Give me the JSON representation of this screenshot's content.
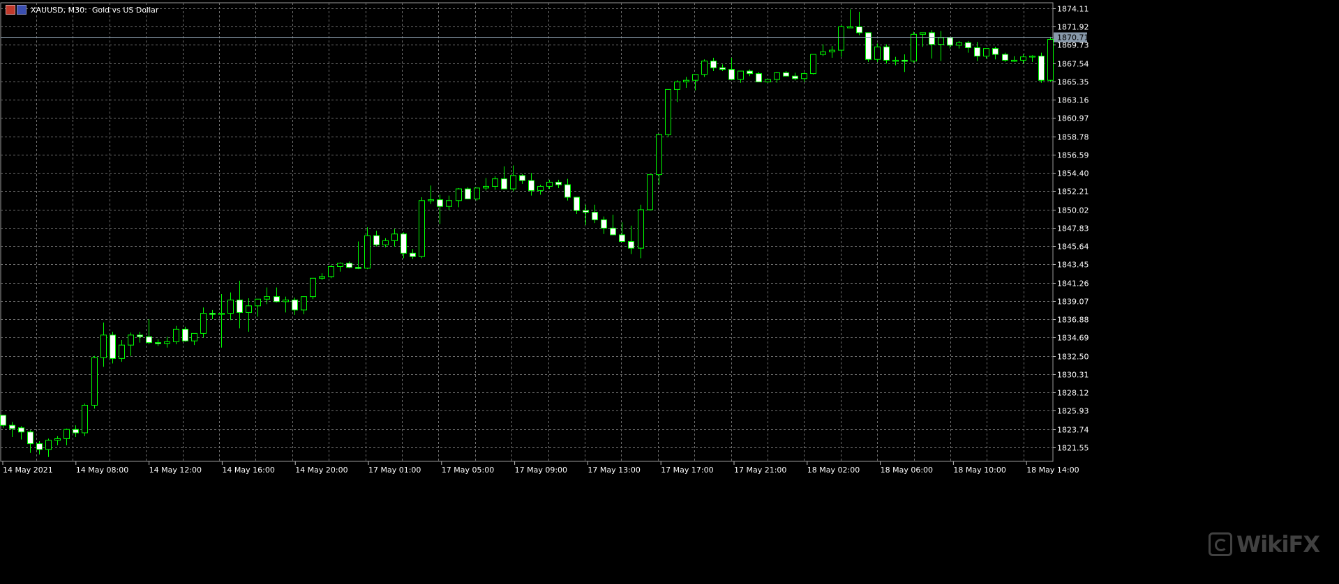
{
  "window": {
    "symbol": "XAUUSD, M30:",
    "description": "Gold vs US Dollar"
  },
  "watermark": {
    "text": "WikiFX"
  },
  "colors": {
    "background": "#000000",
    "grid": "#707070",
    "candle_outline": "#00ff00",
    "bull_body": "#000000",
    "bear_body": "#ffffff",
    "axis_text": "#ffffff",
    "price_line": "#8899aa",
    "price_badge_bg": "#8899aa"
  },
  "chart_data": {
    "type": "candlestick",
    "timeframe": "M30",
    "current_price": 1870.71,
    "price_ticks": [
      "1874.11",
      "1871.92",
      "1869.73",
      "1867.54",
      "1865.35",
      "1863.16",
      "1860.97",
      "1858.78",
      "1856.59",
      "1854.40",
      "1852.21",
      "1850.02",
      "1847.83",
      "1845.64",
      "1843.45",
      "1841.26",
      "1839.07",
      "1836.88",
      "1834.69",
      "1832.50",
      "1830.31",
      "1828.12",
      "1825.93",
      "1823.74",
      "1821.55"
    ],
    "ylim": [
      1820.2,
      1875.1
    ],
    "time_labels": [
      "14 May 2021",
      "14 May 08:00",
      "14 May 12:00",
      "14 May 16:00",
      "14 May 20:00",
      "17 May 01:00",
      "17 May 05:00",
      "17 May 09:00",
      "17 May 13:00",
      "17 May 17:00",
      "17 May 21:00",
      "18 May 02:00",
      "18 May 06:00",
      "18 May 10:00",
      "18 May 14:00"
    ],
    "candles": [
      [
        1825.4,
        1825.4,
        1823.9,
        1824.2
      ],
      [
        1824.2,
        1824.6,
        1822.8,
        1823.8
      ],
      [
        1823.9,
        1824.1,
        1822.5,
        1823.4
      ],
      [
        1823.4,
        1823.6,
        1820.9,
        1822.0
      ],
      [
        1822.0,
        1822.3,
        1820.7,
        1821.3
      ],
      [
        1821.3,
        1822.6,
        1820.4,
        1822.4
      ],
      [
        1822.4,
        1822.9,
        1821.8,
        1822.6
      ],
      [
        1822.6,
        1823.8,
        1821.8,
        1823.7
      ],
      [
        1823.7,
        1824.2,
        1822.8,
        1823.3
      ],
      [
        1823.3,
        1826.8,
        1822.9,
        1826.6
      ],
      [
        1826.6,
        1832.5,
        1826.2,
        1832.3
      ],
      [
        1832.3,
        1836.5,
        1831.2,
        1835.0
      ],
      [
        1835.0,
        1835.4,
        1831.6,
        1832.2
      ],
      [
        1832.2,
        1834.4,
        1831.8,
        1833.8
      ],
      [
        1833.8,
        1835.3,
        1832.5,
        1835.0
      ],
      [
        1835.0,
        1835.4,
        1834.1,
        1834.8
      ],
      [
        1834.8,
        1836.9,
        1833.9,
        1834.1
      ],
      [
        1834.1,
        1834.5,
        1833.7,
        1834.0
      ],
      [
        1834.0,
        1834.8,
        1833.5,
        1834.2
      ],
      [
        1834.2,
        1836.1,
        1833.9,
        1835.7
      ],
      [
        1835.7,
        1836.0,
        1834.2,
        1834.3
      ],
      [
        1834.3,
        1835.1,
        1833.8,
        1835.2
      ],
      [
        1835.2,
        1838.3,
        1834.7,
        1837.6
      ],
      [
        1837.6,
        1838.0,
        1836.9,
        1837.5
      ],
      [
        1837.5,
        1839.9,
        1833.5,
        1837.6
      ],
      [
        1837.6,
        1840.1,
        1836.8,
        1839.2
      ],
      [
        1839.2,
        1841.5,
        1835.8,
        1837.7
      ],
      [
        1837.7,
        1839.4,
        1835.4,
        1838.5
      ],
      [
        1838.5,
        1839.3,
        1837.2,
        1839.3
      ],
      [
        1839.3,
        1840.7,
        1838.7,
        1839.6
      ],
      [
        1839.6,
        1840.7,
        1838.9,
        1839.0
      ],
      [
        1839.0,
        1839.6,
        1837.7,
        1839.2
      ],
      [
        1839.2,
        1839.5,
        1837.4,
        1838.0
      ],
      [
        1838.0,
        1839.6,
        1837.5,
        1839.6
      ],
      [
        1839.6,
        1841.8,
        1839.3,
        1841.8
      ],
      [
        1841.8,
        1842.4,
        1841.6,
        1842.0
      ],
      [
        1842.0,
        1843.4,
        1841.8,
        1843.2
      ],
      [
        1843.2,
        1843.7,
        1842.6,
        1843.6
      ],
      [
        1843.6,
        1843.8,
        1843.0,
        1843.1
      ],
      [
        1843.1,
        1846.2,
        1842.9,
        1843.0
      ],
      [
        1843.0,
        1847.9,
        1842.9,
        1846.9
      ],
      [
        1846.9,
        1847.5,
        1845.6,
        1845.8
      ],
      [
        1845.8,
        1846.6,
        1845.5,
        1846.3
      ],
      [
        1846.3,
        1847.7,
        1845.6,
        1847.1
      ],
      [
        1847.1,
        1847.3,
        1844.2,
        1844.8
      ],
      [
        1844.8,
        1845.3,
        1844.1,
        1844.4
      ],
      [
        1844.4,
        1851.5,
        1844.2,
        1851.1
      ],
      [
        1851.1,
        1852.9,
        1850.7,
        1851.2
      ],
      [
        1851.2,
        1851.8,
        1848.3,
        1850.4
      ],
      [
        1850.4,
        1851.7,
        1850.0,
        1851.1
      ],
      [
        1851.1,
        1852.6,
        1850.3,
        1852.5
      ],
      [
        1852.5,
        1852.7,
        1851.3,
        1851.3
      ],
      [
        1851.3,
        1852.7,
        1851.1,
        1852.6
      ],
      [
        1852.6,
        1853.8,
        1852.3,
        1852.8
      ],
      [
        1852.8,
        1854.0,
        1852.4,
        1853.7
      ],
      [
        1853.7,
        1855.2,
        1852.7,
        1852.5
      ],
      [
        1852.5,
        1855.3,
        1852.2,
        1854.1
      ],
      [
        1854.1,
        1854.3,
        1853.1,
        1853.5
      ],
      [
        1853.5,
        1854.4,
        1851.7,
        1852.3
      ],
      [
        1852.3,
        1853.0,
        1851.8,
        1852.8
      ],
      [
        1852.8,
        1853.6,
        1852.5,
        1853.3
      ],
      [
        1853.3,
        1853.6,
        1852.6,
        1853.0
      ],
      [
        1853.0,
        1853.7,
        1851.1,
        1851.5
      ],
      [
        1851.5,
        1851.5,
        1849.5,
        1849.9
      ],
      [
        1849.9,
        1850.6,
        1848.2,
        1849.7
      ],
      [
        1849.7,
        1850.6,
        1848.4,
        1848.8
      ],
      [
        1848.8,
        1849.2,
        1847.1,
        1847.8
      ],
      [
        1847.8,
        1849.4,
        1847.1,
        1847.0
      ],
      [
        1847.0,
        1848.5,
        1846.2,
        1846.2
      ],
      [
        1846.2,
        1848.1,
        1844.7,
        1845.4
      ],
      [
        1845.4,
        1850.6,
        1844.2,
        1850.0
      ],
      [
        1850.0,
        1854.0,
        1849.9,
        1854.2
      ],
      [
        1854.2,
        1859.1,
        1853.0,
        1859.0
      ],
      [
        1859.0,
        1864.4,
        1858.7,
        1864.4
      ],
      [
        1864.4,
        1865.5,
        1862.9,
        1865.3
      ],
      [
        1865.3,
        1865.9,
        1864.6,
        1865.5
      ],
      [
        1865.5,
        1866.1,
        1864.3,
        1866.2
      ],
      [
        1866.2,
        1868.0,
        1865.9,
        1867.8
      ],
      [
        1867.8,
        1868.2,
        1866.6,
        1867.0
      ],
      [
        1867.0,
        1867.4,
        1866.6,
        1866.8
      ],
      [
        1866.8,
        1868.2,
        1865.5,
        1865.6
      ],
      [
        1865.6,
        1866.6,
        1865.2,
        1866.6
      ],
      [
        1866.6,
        1866.8,
        1866.0,
        1866.3
      ],
      [
        1866.3,
        1866.5,
        1865.5,
        1865.3
      ],
      [
        1865.3,
        1865.6,
        1865.2,
        1865.6
      ],
      [
        1865.6,
        1866.5,
        1865.2,
        1866.4
      ],
      [
        1866.4,
        1866.6,
        1866.0,
        1866.0
      ],
      [
        1866.0,
        1866.4,
        1865.5,
        1865.7
      ],
      [
        1865.7,
        1866.5,
        1865.3,
        1866.3
      ],
      [
        1866.3,
        1868.6,
        1866.2,
        1868.6
      ],
      [
        1868.6,
        1869.8,
        1868.4,
        1868.9
      ],
      [
        1868.9,
        1869.6,
        1868.2,
        1869.1
      ],
      [
        1869.1,
        1872.1,
        1868.3,
        1871.9
      ],
      [
        1871.9,
        1874.0,
        1871.8,
        1871.9
      ],
      [
        1871.9,
        1873.7,
        1870.9,
        1871.2
      ],
      [
        1871.2,
        1871.2,
        1867.7,
        1868.0
      ],
      [
        1868.0,
        1869.9,
        1867.7,
        1869.5
      ],
      [
        1869.5,
        1869.8,
        1867.5,
        1867.9
      ],
      [
        1867.9,
        1868.3,
        1867.3,
        1867.9
      ],
      [
        1867.9,
        1868.6,
        1866.5,
        1867.8
      ],
      [
        1867.8,
        1871.3,
        1867.6,
        1871.0
      ],
      [
        1871.0,
        1871.2,
        1869.5,
        1871.2
      ],
      [
        1871.2,
        1871.5,
        1868.1,
        1869.8
      ],
      [
        1869.8,
        1871.4,
        1867.8,
        1870.6
      ],
      [
        1870.6,
        1870.6,
        1869.3,
        1869.7
      ],
      [
        1869.7,
        1870.2,
        1869.3,
        1870.0
      ],
      [
        1870.0,
        1870.2,
        1868.8,
        1869.4
      ],
      [
        1869.4,
        1870.1,
        1867.8,
        1868.4
      ],
      [
        1868.4,
        1869.2,
        1868.1,
        1869.3
      ],
      [
        1869.3,
        1869.5,
        1868.0,
        1868.6
      ],
      [
        1868.6,
        1868.8,
        1867.7,
        1867.9
      ],
      [
        1867.9,
        1868.4,
        1867.7,
        1867.9
      ],
      [
        1867.9,
        1868.6,
        1867.5,
        1868.3
      ],
      [
        1868.3,
        1868.5,
        1867.7,
        1868.4
      ],
      [
        1868.4,
        1868.8,
        1865.2,
        1865.5
      ],
      [
        1865.5,
        1870.7,
        1865.3,
        1870.4
      ],
      [
        1870.4,
        1870.9,
        1870.1,
        1870.71
      ]
    ]
  }
}
